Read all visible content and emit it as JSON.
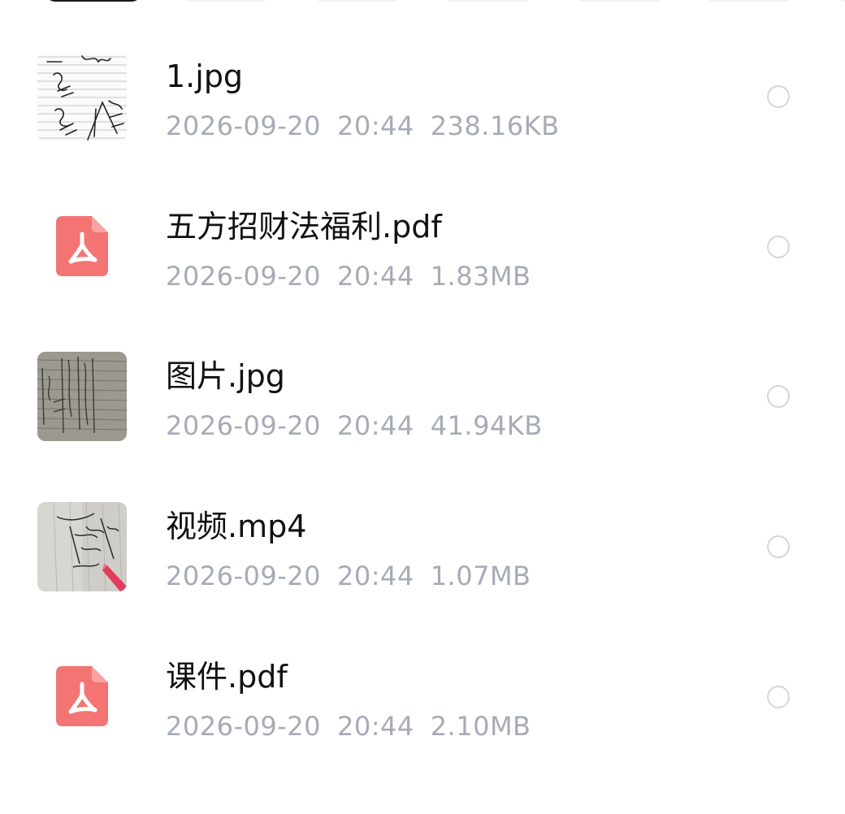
{
  "colors": {
    "pdf_red": "#f47474",
    "meta_gray": "#a7abb7",
    "name_black": "#111111",
    "radio_border": "#d4d6db"
  },
  "files": [
    {
      "name": "1.jpg",
      "date": "2026-09-20",
      "time": "20:44",
      "size": "238.16KB",
      "icon": "image-thumbnail",
      "selected": false
    },
    {
      "name": "五方招财法福利.pdf",
      "date": "2026-09-20",
      "time": "20:44",
      "size": "1.83MB",
      "icon": "pdf-icon",
      "selected": false
    },
    {
      "name": "图片.jpg",
      "date": "2026-09-20",
      "time": "20:44",
      "size": "41.94KB",
      "icon": "image-thumbnail",
      "selected": false
    },
    {
      "name": "视频.mp4",
      "date": "2026-09-20",
      "time": "20:44",
      "size": "1.07MB",
      "icon": "video-thumbnail",
      "selected": false
    },
    {
      "name": "课件.pdf",
      "date": "2026-09-20",
      "time": "20:44",
      "size": "2.10MB",
      "icon": "pdf-icon",
      "selected": false
    }
  ]
}
